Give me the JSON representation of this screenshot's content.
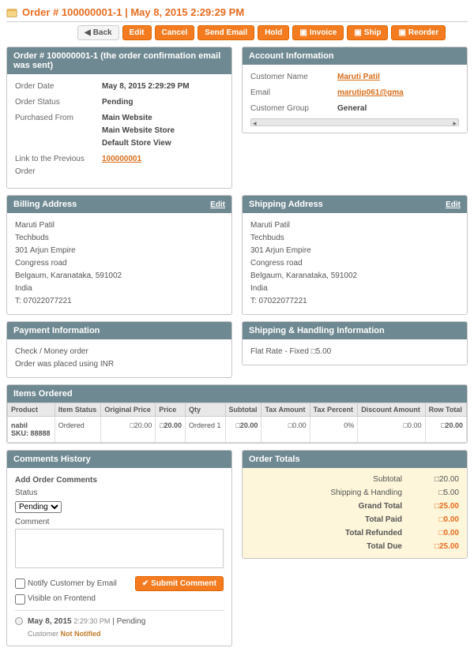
{
  "header": {
    "title": "Order # 100000001-1 | May 8, 2015 2:29:29 PM"
  },
  "buttons": {
    "back": "Back",
    "edit": "Edit",
    "cancel": "Cancel",
    "send_email": "Send Email",
    "hold": "Hold",
    "invoice": "Invoice",
    "ship": "Ship",
    "reorder": "Reorder"
  },
  "order_info": {
    "heading": "Order # 100000001-1 (the order confirmation email was sent)",
    "date_label": "Order Date",
    "date_value": "May 8, 2015 2:29:29 PM",
    "status_label": "Order Status",
    "status_value": "Pending",
    "from_label": "Purchased From",
    "from_value": "Main Website\nMain Website Store\nDefault Store View",
    "prev_label": "Link to the Previous Order",
    "prev_value": "100000001"
  },
  "account": {
    "heading": "Account Information",
    "name_label": "Customer Name",
    "name_value": "Maruti Patil",
    "email_label": "Email",
    "email_value": "marutip061@gma",
    "group_label": "Customer Group",
    "group_value": "General"
  },
  "billing": {
    "heading": "Billing Address",
    "edit": "Edit",
    "text": "Maruti Patil\nTechbuds\n301 Arjun Empire\nCongress road\nBelgaum, Karanataka, 591002\nIndia\nT: 07022077221"
  },
  "shipping_addr": {
    "heading": "Shipping Address",
    "edit": "Edit",
    "text": "Maruti Patil\nTechbuds\n301 Arjun Empire\nCongress road\nBelgaum, Karanataka, 591002\nIndia\nT: 07022077221"
  },
  "payment": {
    "heading": "Payment Information",
    "text": "Check / Money order\nOrder was placed using INR"
  },
  "shipping_method": {
    "heading": "Shipping & Handling Information",
    "text": "Flat Rate - Fixed □5.00"
  },
  "items": {
    "heading": "Items Ordered",
    "cols": {
      "product": "Product",
      "status": "Item Status",
      "orig": "Original Price",
      "price": "Price",
      "qty": "Qty",
      "subtotal": "Subtotal",
      "tax_amt": "Tax Amount",
      "tax_pct": "Tax Percent",
      "discount": "Discount Amount",
      "row_total": "Row Total"
    },
    "row": {
      "product": "nabil\nSKU: 88888",
      "status": "Ordered",
      "orig": "□20.00",
      "price": "□20.00",
      "qty": "Ordered  1",
      "subtotal": "□20.00",
      "tax_amt": "□0.00",
      "tax_pct": "0%",
      "discount": "□0.00",
      "row_total": "□20.00"
    }
  },
  "comments": {
    "heading": "Comments History",
    "add_label": "Add Order Comments",
    "status_label": "Status",
    "status_value": "Pending",
    "comment_label": "Comment",
    "notify_email": "Notify Customer by Email",
    "visible_front": "Visible on Frontend",
    "submit": "Submit Comment",
    "entry_date": "May 8, 2015",
    "entry_time": "2:29:30 PM",
    "entry_status": "Pending",
    "entry_cust_label": "Customer",
    "entry_cust_value": "Not Notified"
  },
  "totals": {
    "heading": "Order Totals",
    "subtotal_l": "Subtotal",
    "subtotal_v": "□20.00",
    "ship_l": "Shipping & Handling",
    "ship_v": "□5.00",
    "grand_l": "Grand Total",
    "grand_v": "□25.00",
    "paid_l": "Total Paid",
    "paid_v": "□0.00",
    "refund_l": "Total Refunded",
    "refund_v": "□0.00",
    "due_l": "Total Due",
    "due_v": "□25.00"
  }
}
